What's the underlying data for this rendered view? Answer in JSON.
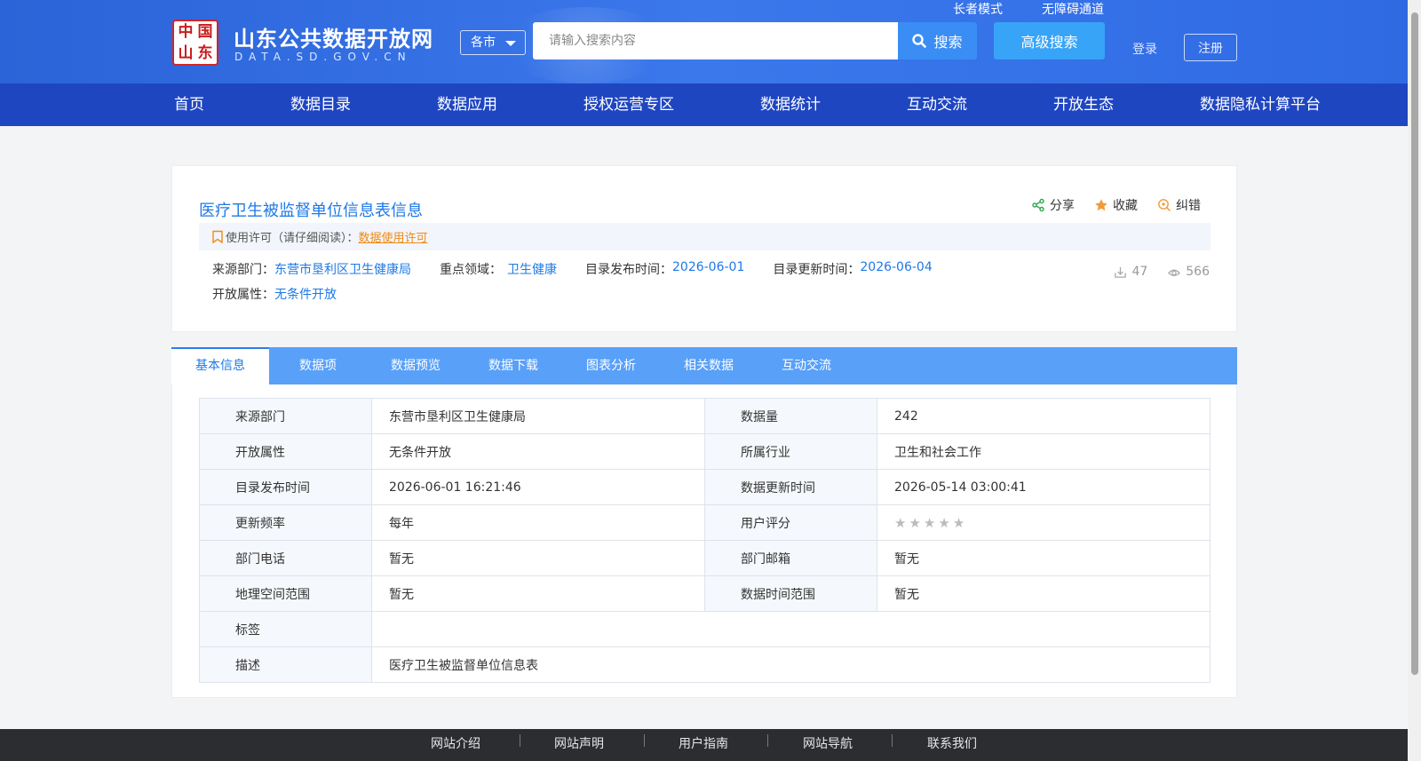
{
  "header": {
    "seal_chars": [
      "中",
      "国",
      "山",
      "东"
    ],
    "site_title": "山东公共数据开放网",
    "site_domain": "DATA.SD.GOV.CN",
    "region_label": "各市",
    "search_placeholder": "请输入搜索内容",
    "search_label": "搜索",
    "advanced_search_label": "高级搜索",
    "elder_mode": "长者模式",
    "accessibility": "无障碍通道",
    "login": "登录",
    "register": "注册"
  },
  "nav": [
    "首页",
    "数据目录",
    "数据应用",
    "授权运营专区",
    "数据统计",
    "互动交流",
    "开放生态",
    "数据隐私计算平台"
  ],
  "dataset": {
    "title": "医疗卫生被监督单位信息表信息",
    "actions": {
      "share": "分享",
      "favorite": "收藏",
      "report": "纠错"
    },
    "license_prefix": "使用许可（请仔细阅读）：",
    "license_link": "数据使用许可",
    "source_dept_label": "来源部门：",
    "source_dept": "东营市垦利区卫生健康局",
    "domain_label": "重点领域：",
    "domain": "卫生健康",
    "publish_label": "目录发布时间：",
    "publish_date": "2026-06-01",
    "update_label": "目录更新时间：",
    "update_date": "2026-06-04",
    "open_attr_label": "开放属性：",
    "open_attr": "无条件开放",
    "downloads": "47",
    "views": "566"
  },
  "tabs": [
    "基本信息",
    "数据项",
    "数据预览",
    "数据下载",
    "图表分析",
    "相关数据",
    "互动交流"
  ],
  "info_table": {
    "rows": [
      {
        "k1": "来源部门",
        "v1": "东营市垦利区卫生健康局",
        "k2": "数据量",
        "v2": "242"
      },
      {
        "k1": "开放属性",
        "v1": "无条件开放",
        "k2": "所属行业",
        "v2": "卫生和社会工作"
      },
      {
        "k1": "目录发布时间",
        "v1": "2026-06-01 16:21:46",
        "k2": "数据更新时间",
        "v2": "2026-05-14 03:00:41"
      },
      {
        "k1": "更新频率",
        "v1": "每年",
        "k2": "用户评分",
        "v2": ""
      },
      {
        "k1": "部门电话",
        "v1": "暂无",
        "k2": "部门邮箱",
        "v2": "暂无"
      },
      {
        "k1": "地理空间范围",
        "v1": "暂无",
        "k2": "数据时间范围",
        "v2": "暂无"
      }
    ],
    "tags_label": "标签",
    "tags_value": "",
    "desc_label": "描述",
    "desc_value": "医疗卫生被监督单位信息表",
    "rating": 0,
    "rating_max": 5
  },
  "footer": [
    "网站介绍",
    "网站声明",
    "用户指南",
    "网站导航",
    "联系我们"
  ],
  "colors": {
    "primary": "#1e79e6",
    "nav": "#1f46c1",
    "license_link": "#f08a16",
    "tab_bar": "#59a0f9"
  }
}
